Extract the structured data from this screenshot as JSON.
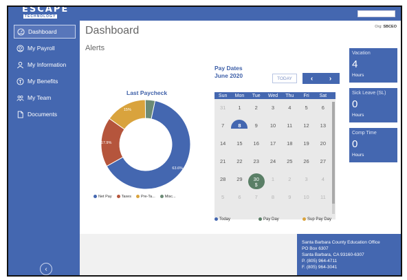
{
  "brand": {
    "logo_text": "ESCAPE",
    "logo_sub": "TECHNOLOGY"
  },
  "sidebar": {
    "items": [
      {
        "label": "Dashboard",
        "icon": "gauge-icon",
        "active": true
      },
      {
        "label": "My Payroll",
        "icon": "payroll-icon",
        "active": false
      },
      {
        "label": "My Information",
        "icon": "person-icon",
        "active": false
      },
      {
        "label": "My Benefits",
        "icon": "benefits-icon",
        "active": false
      },
      {
        "label": "My Team",
        "icon": "team-icon",
        "active": false
      },
      {
        "label": "Documents",
        "icon": "document-icon",
        "active": false
      }
    ],
    "collapse_icon": "chevron-left-icon"
  },
  "main": {
    "title": "Dashboard",
    "alerts_title": "Alerts"
  },
  "paycheck": {
    "title": "Last Paycheck",
    "slices": [
      {
        "name": "Net Pay",
        "value": 63.6,
        "label": "63.6%",
        "color": "#4467b0"
      },
      {
        "name": "Taxes",
        "value": 17.9,
        "label": "17.9%",
        "color": "#b5553c"
      },
      {
        "name": "Pre-Ta...",
        "value": 15,
        "label": "15%",
        "color": "#d9a33d"
      },
      {
        "name": "Misc...",
        "value": 3.5,
        "label": "",
        "color": "#6b8a75"
      }
    ]
  },
  "calendar": {
    "heading": "Pay Dates",
    "month": "June 2020",
    "today_label": "TODAY",
    "prev_icon": "chevron-left-icon",
    "next_icon": "chevron-right-icon",
    "weekdays": [
      "Sun",
      "Mon",
      "Tue",
      "Wed",
      "Thu",
      "Fri",
      "Sat"
    ],
    "weeks": [
      [
        {
          "d": "31",
          "m": true
        },
        {
          "d": "1"
        },
        {
          "d": "2"
        },
        {
          "d": "3"
        },
        {
          "d": "4"
        },
        {
          "d": "5"
        },
        {
          "d": "6"
        }
      ],
      [
        {
          "d": "7"
        },
        {
          "d": "8",
          "today": true
        },
        {
          "d": "9"
        },
        {
          "d": "10"
        },
        {
          "d": "11"
        },
        {
          "d": "12"
        },
        {
          "d": "13"
        }
      ],
      [
        {
          "d": "14"
        },
        {
          "d": "15"
        },
        {
          "d": "16"
        },
        {
          "d": "17"
        },
        {
          "d": "18"
        },
        {
          "d": "19"
        },
        {
          "d": "20"
        }
      ],
      [
        {
          "d": "21"
        },
        {
          "d": "22"
        },
        {
          "d": "23"
        },
        {
          "d": "24"
        },
        {
          "d": "25"
        },
        {
          "d": "26"
        },
        {
          "d": "27"
        }
      ],
      [
        {
          "d": "28"
        },
        {
          "d": "29"
        },
        {
          "d": "30",
          "payday": true,
          "symbol": "$"
        },
        {
          "d": "1",
          "m": true
        },
        {
          "d": "2",
          "m": true
        },
        {
          "d": "3",
          "m": true
        },
        {
          "d": "4",
          "m": true
        }
      ],
      [
        {
          "d": "5",
          "m": true
        },
        {
          "d": "6",
          "m": true
        },
        {
          "d": "7",
          "m": true
        },
        {
          "d": "8",
          "m": true
        },
        {
          "d": "9",
          "m": true
        },
        {
          "d": "10",
          "m": true
        },
        {
          "d": "11",
          "m": true
        }
      ]
    ],
    "legend": [
      {
        "label": "Today",
        "color": "#4467b0"
      },
      {
        "label": "Pay Day",
        "color": "#5a7f66"
      },
      {
        "label": "Sup Pay Day",
        "color": "#d9a33d"
      }
    ]
  },
  "org": {
    "label": "Org:",
    "code": "SBCEO"
  },
  "balances": [
    {
      "label": "Vacation",
      "value": "4",
      "unit": "Hours"
    },
    {
      "label": "Sick Leave (SL)",
      "value": "0",
      "unit": "Hours"
    },
    {
      "label": "Comp Time",
      "value": "0",
      "unit": "Hours"
    }
  ],
  "footer": {
    "lines": [
      "Santa Barbara County Education Office",
      "PO Box 6307",
      "Santa Barbara, CA 93160-6307",
      "P. (805) 964-4711",
      "F. (805) 964-3041"
    ]
  }
}
